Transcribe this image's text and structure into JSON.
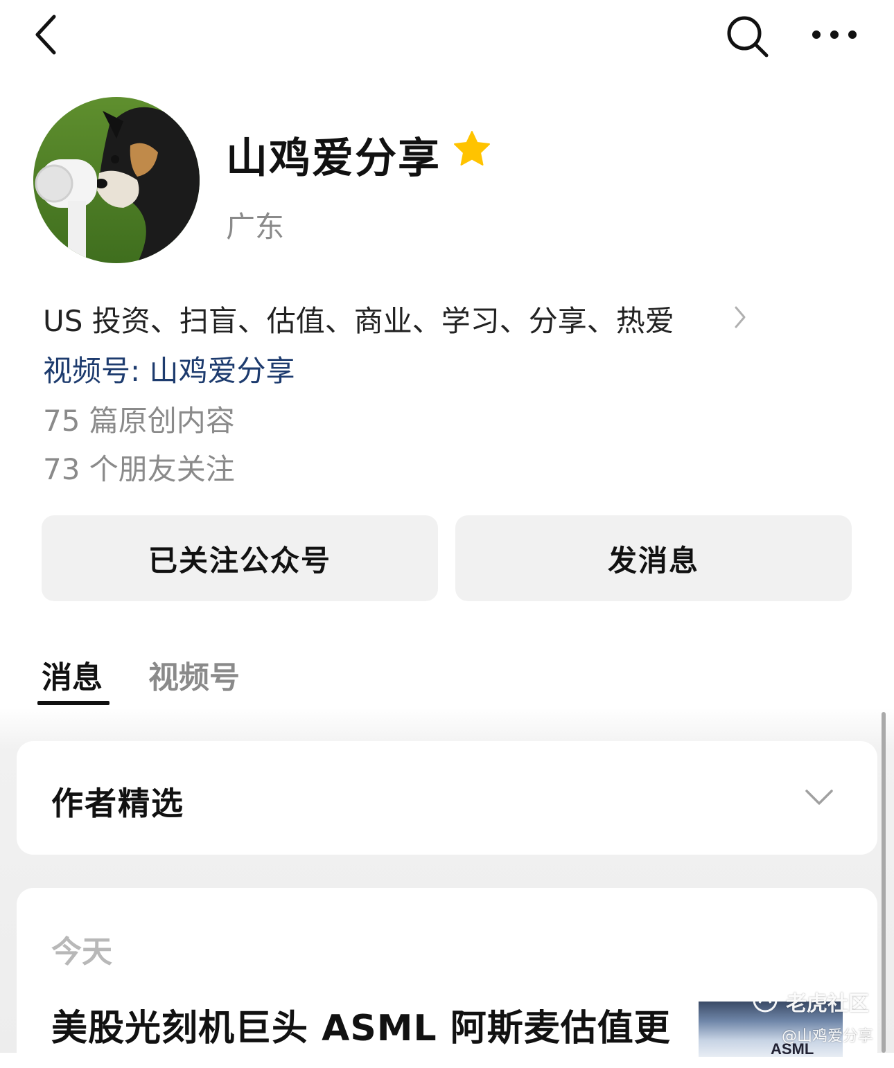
{
  "header": {
    "back_icon": "back-chevron-icon",
    "search_icon": "search-icon",
    "more_icon": "more-dots-icon"
  },
  "profile": {
    "name": "山鸡爱分享",
    "star_icon": "star-icon",
    "star_color": "#FFC300",
    "region": "广东",
    "bio": "US 投资、扫盲、估值、商业、学习、分享、热爱",
    "channel": "视频号: 山鸡爱分享",
    "articles_count": "75 篇原创内容",
    "friends_following": "73 个朋友关注"
  },
  "actions": {
    "follow_label": "已关注公众号",
    "message_label": "发消息"
  },
  "tabs": [
    {
      "label": "消息",
      "active": true
    },
    {
      "label": "视频号",
      "active": false
    }
  ],
  "featured": {
    "title": "作者精选"
  },
  "feed": {
    "date_label": "今天",
    "article_title": "美股光刻机巨头 ASML 阿斯麦估值更",
    "thumbnail_text": "ASML"
  },
  "watermark": {
    "line1": "老虎社区",
    "line2": "@山鸡爱分享"
  }
}
